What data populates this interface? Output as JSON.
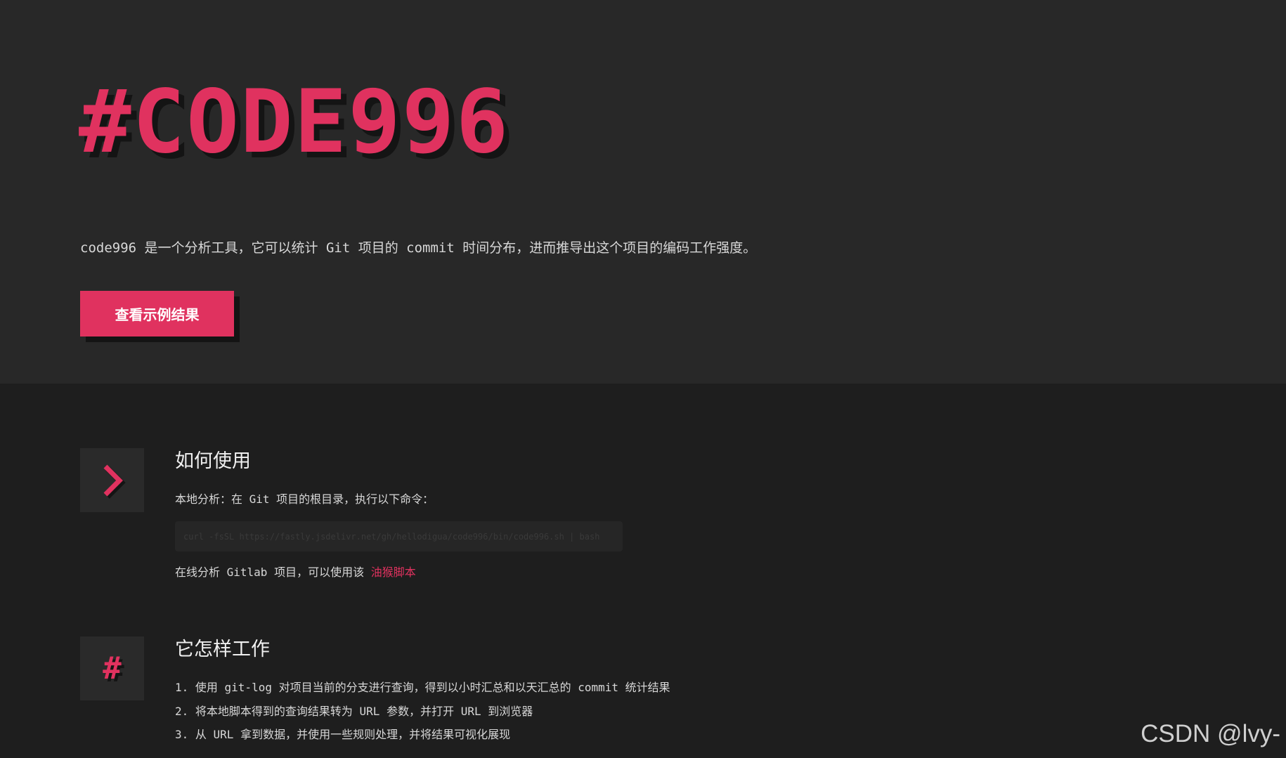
{
  "hero": {
    "title": "#CODE996",
    "description": "code996 是一个分析工具，它可以统计 Git 项目的 commit 时间分布，进而推导出这个项目的编码工作强度。",
    "button_label": "查看示例结果"
  },
  "usage": {
    "title": "如何使用",
    "local_label": "本地分析：在 Git 项目的根目录，执行以下命令：",
    "command": "curl -fsSL https://fastly.jsdelivr.net/gh/hellodigua/code996/bin/code996.sh | bash",
    "online_prefix": "在线分析 Gitlab 项目，可以使用该",
    "online_link": "油猴脚本"
  },
  "how": {
    "title": "它怎样工作",
    "steps": [
      "1. 使用 git-log 对项目当前的分支进行查询，得到以小时汇总和以天汇总的 commit 统计结果",
      "2. 将本地脚本得到的查询结果转为 URL 参数，并打开 URL 到浏览器",
      "3. 从 URL 拿到数据，并使用一些规则处理，并将结果可视化展现"
    ]
  },
  "icons": {
    "usage": "chevron-right-icon",
    "how": "hash-icon"
  },
  "colors": {
    "accent": "#e0325f",
    "hero_bg": "#282828",
    "page_bg": "#1e1e1e"
  },
  "watermark": "CSDN @lvy-"
}
